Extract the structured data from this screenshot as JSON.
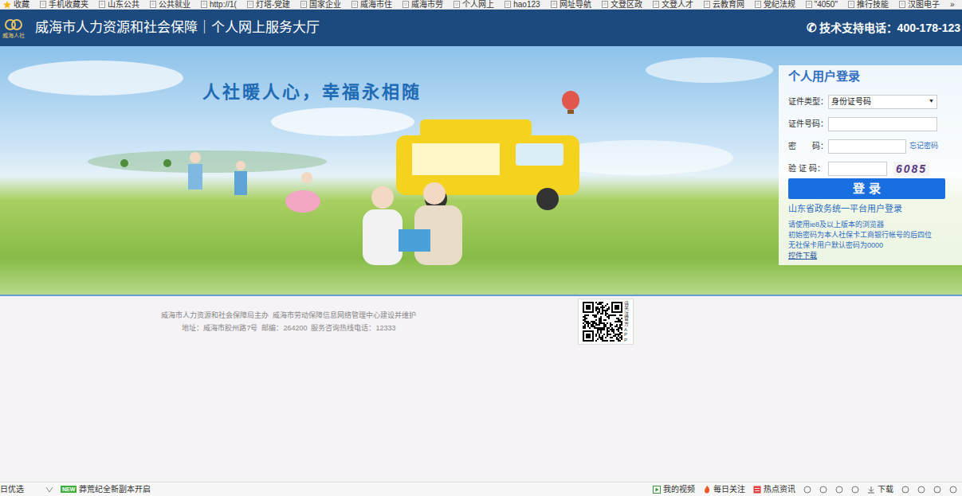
{
  "bookmarks": [
    "收藏",
    "手机收藏夹",
    "山东公共",
    "公共就业",
    "http://1(",
    "灯塔-党建",
    "国家企业",
    "威海市住",
    "威海市劳",
    "个人网上",
    "hao123",
    "网址导航",
    "文登区政",
    "文登人才",
    "云教育网",
    "党纪法规",
    "\"4050\"",
    "推行技能",
    "汉图电子",
    "»"
  ],
  "header": {
    "logo": "威海人社",
    "title": "威海市人力资源和社会保障｜个人网上服务大厅",
    "phone_icon": "✆",
    "support": "技术支持电话：400-178-123"
  },
  "banner": {
    "slogan": "人社暖人心，幸福永相随"
  },
  "login": {
    "title": "个人用户登录",
    "fields": [
      {
        "label": "证件类型：",
        "kind": "select",
        "value": "身份证号码",
        "arrow": "▼"
      },
      {
        "label": "证件号码：",
        "kind": "input"
      },
      {
        "label": "密　　码：",
        "kind": "password",
        "link": "忘记密码"
      },
      {
        "label": "验 证 码：",
        "kind": "captcha",
        "captcha": "6085"
      }
    ],
    "button": "登 录",
    "alt_login": "山东省政务统一平台用户登录",
    "notes": [
      "请使用ie8及以上版本的浏览器",
      "初始密码为本人社保卡工商银行帐号的后四位",
      "无社保卡用户默认密码为0000"
    ],
    "download": "控件下载"
  },
  "footer": {
    "lines": [
      "威海市人力资源和社会保障局主办  威海市劳动保障信息网络管理中心建设并维护",
      "地址：威海市胶州路7号  邮编：264200  服务咨询热线电话：12333"
    ],
    "qr_caption": "请关注官方APP"
  },
  "status_bar": {
    "left_text": "日优选",
    "badge": "NEW",
    "news": "莽荒纪全新副本开启",
    "right": [
      "我的视频",
      "每日关注",
      "热点资讯",
      "下载"
    ]
  }
}
